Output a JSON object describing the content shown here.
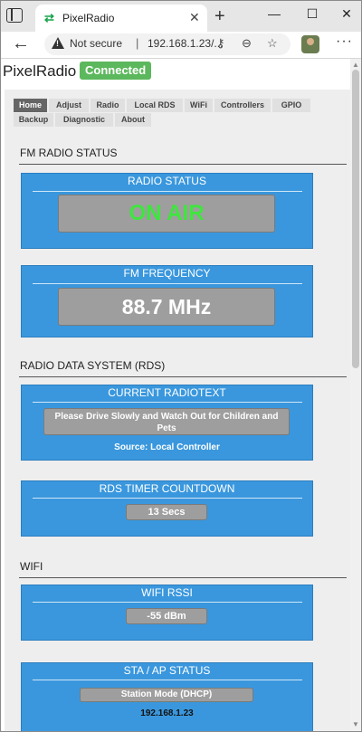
{
  "browser": {
    "tab_title": "PixelRadio",
    "security_label": "Not secure",
    "url": "192.168.1.23/..."
  },
  "header": {
    "app_title": "PixelRadio",
    "status_badge": "Connected"
  },
  "nav": {
    "row1": [
      "Home",
      "Adjust",
      "Radio",
      "Local RDS",
      "WiFi",
      "Controllers",
      "GPIO"
    ],
    "row2": [
      "Backup",
      "Diagnostic",
      "About"
    ],
    "active": "Home"
  },
  "fm": {
    "section_title": "FM RADIO STATUS",
    "radio_status_label": "RADIO STATUS",
    "radio_status_value": "ON AIR",
    "frequency_label": "FM FREQUENCY",
    "frequency_value": "88.7 MHz"
  },
  "rds": {
    "section_title": "RADIO DATA SYSTEM (RDS)",
    "radiotext_label": "CURRENT RADIOTEXT",
    "radiotext_line1": "Please Drive Slowly and Watch Out for Children and",
    "radiotext_line2": "Pets",
    "source": "Source: Local Controller",
    "timer_label": "RDS TIMER COUNTDOWN",
    "timer_value": "13 Secs"
  },
  "wifi": {
    "section_title": "WIFI",
    "rssi_label": "WIFI RSSI",
    "rssi_value": "-55 dBm",
    "sta_label": "STA / AP STATUS",
    "sta_value": "Station Mode (DHCP)",
    "ip_address": "192.168.1.23"
  },
  "colors": {
    "card_blue": "#3a97dd",
    "on_air_green": "#3ee63e",
    "badge_green": "#5cb85c"
  }
}
